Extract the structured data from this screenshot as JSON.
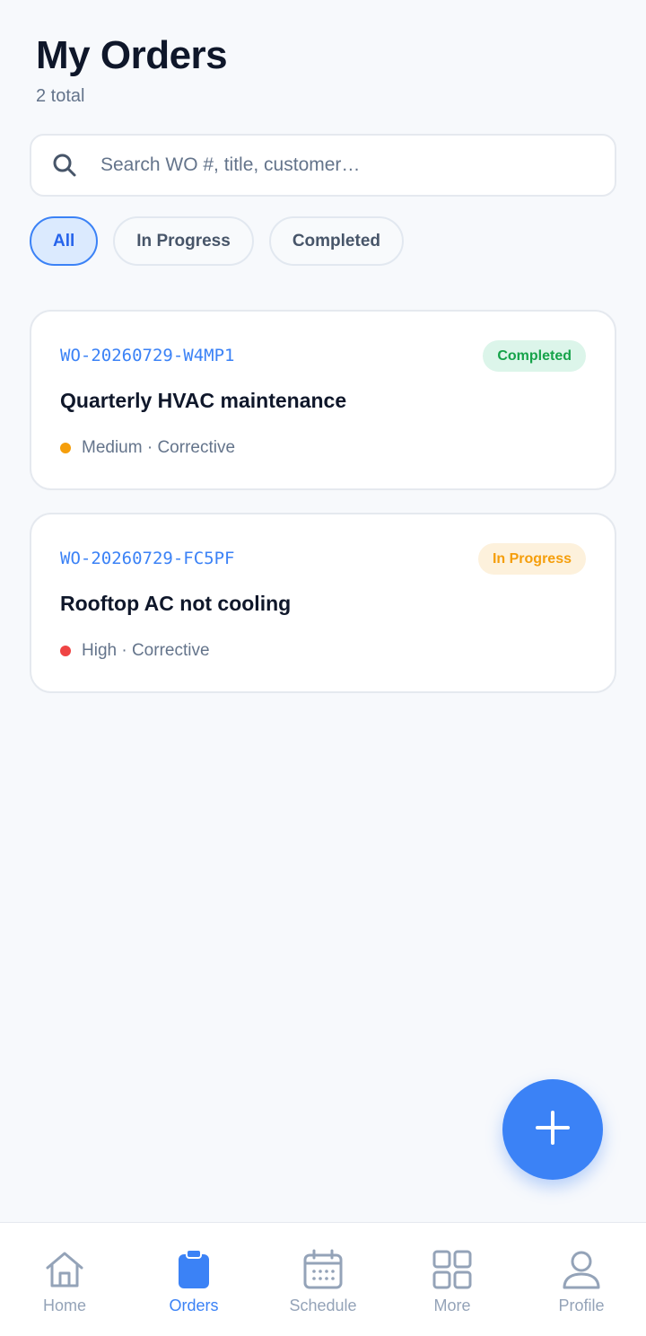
{
  "header": {
    "title": "My Orders",
    "subtitle": "2 total"
  },
  "search": {
    "placeholder": "Search WO #, title, customer…",
    "value": ""
  },
  "filters": [
    {
      "label": "All",
      "active": true
    },
    {
      "label": "In Progress",
      "active": false
    },
    {
      "label": "Completed",
      "active": false
    }
  ],
  "orders": [
    {
      "wo_number": "WO-20260729-W4MP1",
      "status": "Completed",
      "title": "Quarterly HVAC maintenance",
      "meta": "Medium · Corrective",
      "priority_color": "#f59e0b"
    },
    {
      "wo_number": "WO-20260729-FC5PF",
      "status": "In Progress",
      "title": "Rooftop AC not cooling",
      "meta": "High · Corrective",
      "priority_color": "#ef4444"
    }
  ],
  "fab": {
    "icon": "plus-icon"
  },
  "tabs": [
    {
      "label": "Home",
      "icon": "home-icon",
      "active": false
    },
    {
      "label": "Orders",
      "icon": "clipboard-icon",
      "active": true
    },
    {
      "label": "Schedule",
      "icon": "calendar-icon",
      "active": false
    },
    {
      "label": "More",
      "icon": "grid-icon",
      "active": false
    },
    {
      "label": "Profile",
      "icon": "user-icon",
      "active": false
    }
  ],
  "colors": {
    "accent": "#3b82f6",
    "background": "#f7f9fc",
    "completed": "#16a34a",
    "in_progress": "#f59e0b"
  }
}
